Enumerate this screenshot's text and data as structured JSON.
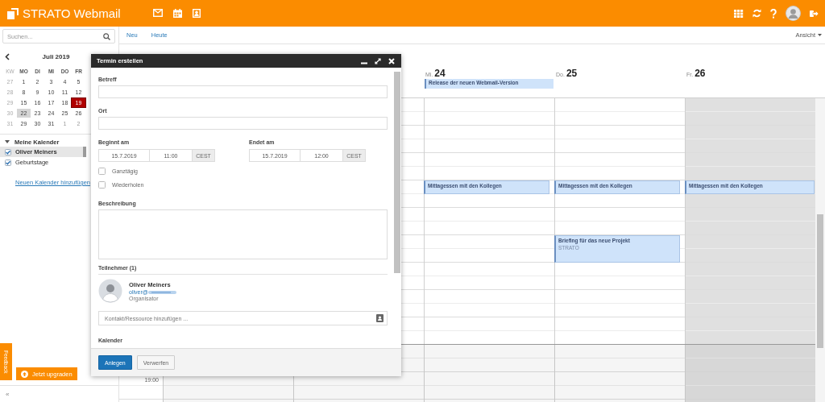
{
  "header": {
    "brand": "**STRATO** Webmail"
  },
  "search": {
    "placeholder": "Suchen..."
  },
  "mini_calendar": {
    "month": "Juli 2019",
    "headers": [
      "KW",
      "MO",
      "DI",
      "MI",
      "DO",
      "FR"
    ],
    "weeks": [
      {
        "kw": "27",
        "days": [
          {
            "label": "1",
            "today": false,
            "selected": false,
            "other_month": false
          },
          {
            "label": "2",
            "today": false,
            "selected": false,
            "other_month": false
          },
          {
            "label": "3",
            "today": false,
            "selected": false,
            "other_month": false
          },
          {
            "label": "4",
            "today": false,
            "selected": false,
            "other_month": false
          },
          {
            "label": "5",
            "today": false,
            "selected": false,
            "other_month": false
          }
        ]
      },
      {
        "kw": "28",
        "days": [
          {
            "label": "8",
            "today": false,
            "selected": false,
            "other_month": false
          },
          {
            "label": "9",
            "today": false,
            "selected": false,
            "other_month": false
          },
          {
            "label": "10",
            "today": false,
            "selected": false,
            "other_month": false
          },
          {
            "label": "11",
            "today": false,
            "selected": false,
            "other_month": false
          },
          {
            "label": "12",
            "today": false,
            "selected": false,
            "other_month": false
          }
        ]
      },
      {
        "kw": "29",
        "days": [
          {
            "label": "15",
            "today": false,
            "selected": false,
            "other_month": false
          },
          {
            "label": "16",
            "today": false,
            "selected": false,
            "other_month": false
          },
          {
            "label": "17",
            "today": false,
            "selected": false,
            "other_month": false
          },
          {
            "label": "18",
            "today": false,
            "selected": false,
            "other_month": false
          },
          {
            "label": "19",
            "today": true,
            "selected": false,
            "other_month": false
          }
        ]
      },
      {
        "kw": "30",
        "days": [
          {
            "label": "22",
            "today": false,
            "selected": true,
            "other_month": false
          },
          {
            "label": "23",
            "today": false,
            "selected": false,
            "other_month": false
          },
          {
            "label": "24",
            "today": false,
            "selected": false,
            "other_month": false
          },
          {
            "label": "25",
            "today": false,
            "selected": false,
            "other_month": false
          },
          {
            "label": "26",
            "today": false,
            "selected": false,
            "other_month": false
          }
        ]
      },
      {
        "kw": "31",
        "days": [
          {
            "label": "29",
            "today": false,
            "selected": false,
            "other_month": false
          },
          {
            "label": "30",
            "today": false,
            "selected": false,
            "other_month": false
          },
          {
            "label": "31",
            "today": false,
            "selected": false,
            "other_month": false
          },
          {
            "label": "1",
            "today": false,
            "selected": false,
            "other_month": true
          },
          {
            "label": "2",
            "today": false,
            "selected": false,
            "other_month": true
          }
        ]
      }
    ]
  },
  "calendars": {
    "title": "Meine Kalender",
    "expanded": true,
    "items": [
      {
        "name": "Oliver Meiners",
        "checked": true,
        "selected": true
      },
      {
        "name": "Geburtstage",
        "checked": true,
        "selected": false
      }
    ],
    "add_link": "Neuen Kalender hinzufügen"
  },
  "feedback_tab": "Feedback",
  "upgrade_button": "Jetzt upgraden",
  "collapse": "«",
  "toolbar": {
    "buttons": [
      "Neu",
      "Heute"
    ],
    "view_menu": "Ansicht"
  },
  "week": {
    "time_labels": [
      "19:00"
    ],
    "days": [
      {
        "weekday": "Mi.",
        "date": "24",
        "shaded": false,
        "all_day_events": [
          "Release der neuen Webmail-Version"
        ],
        "events": [
          {
            "title": "Mittagessen mit den Kollegen"
          }
        ]
      },
      {
        "weekday": "Do.",
        "date": "25",
        "shaded": false,
        "events": [
          {
            "title": "Mittagessen mit den Kollegen"
          },
          {
            "title": "Briefing für das neue Projekt",
            "location": "STRATO"
          }
        ]
      },
      {
        "weekday": "Fr.",
        "date": "26",
        "shaded": true,
        "events": [
          {
            "title": "Mittagessen mit den Kollegen"
          }
        ]
      }
    ]
  },
  "dialog": {
    "title": "Termin erstellen",
    "subject_label": "Betreff",
    "location_label": "Ort",
    "start": {
      "label": "Beginnt am",
      "date": "15.7.2019",
      "time": "11:00",
      "timezone": "CEST"
    },
    "end": {
      "label": "Endet am",
      "date": "15.7.2019",
      "time": "12:00",
      "timezone": "CEST"
    },
    "options": [
      {
        "label": "Ganztägig",
        "checked": false
      },
      {
        "label": "Wiederholen",
        "checked": false
      }
    ],
    "description_label": "Beschreibung",
    "participants_label": "Teilnehmer (1)",
    "participant": {
      "name": "Oliver Meiners",
      "email": "oliver@",
      "role": "Organisator"
    },
    "contact_placeholder": "Kontakt/Ressource hinzufügen ...",
    "calendar_label": "Kalender",
    "buttons": [
      {
        "label": "Anlegen",
        "kind": "primary"
      },
      {
        "label": "Verwerfen",
        "kind": "secondary"
      }
    ]
  }
}
